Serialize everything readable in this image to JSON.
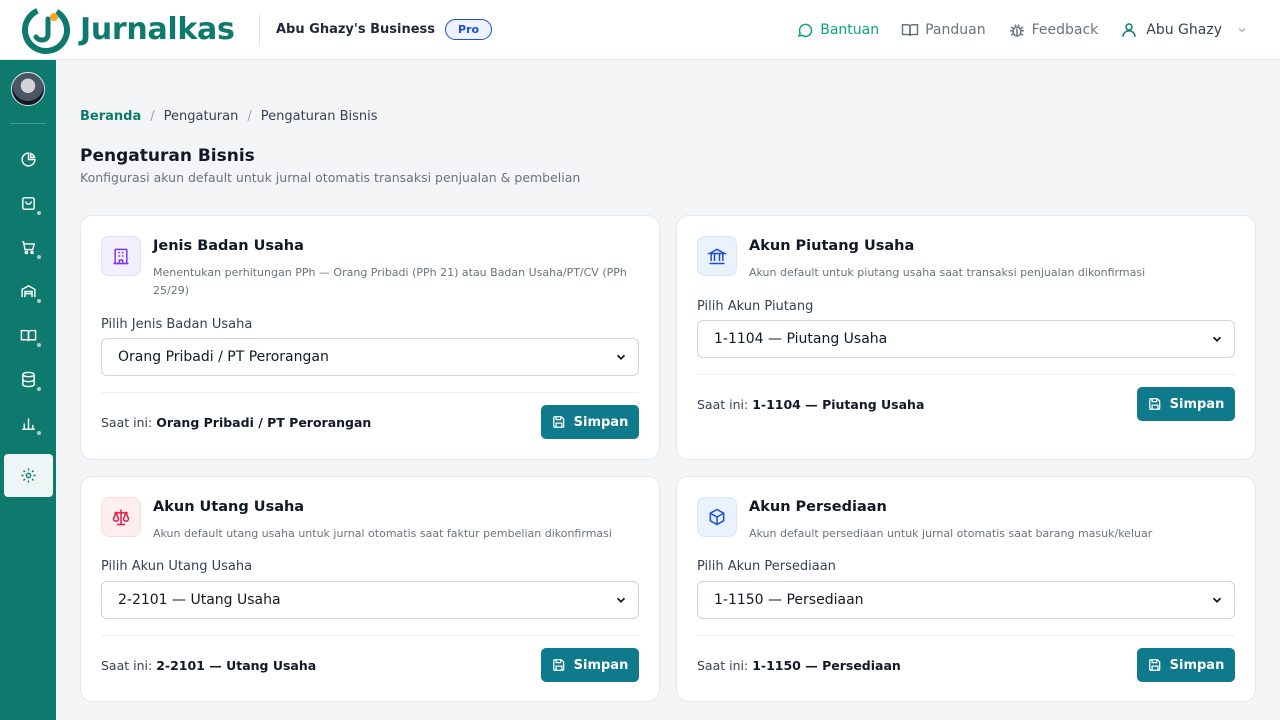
{
  "brand": {
    "name": "Jurnalkas"
  },
  "business": {
    "name": "Abu Ghazy's Business",
    "plan": "Pro"
  },
  "top_nav": {
    "help": "Bantuan",
    "guide": "Panduan",
    "feedback": "Feedback",
    "user": "Abu Ghazy"
  },
  "breadcrumb": {
    "home": "Beranda",
    "sep": "/",
    "level1": "Pengaturan",
    "level2": "Pengaturan Bisnis"
  },
  "page": {
    "title": "Pengaturan Bisnis",
    "subtitle": "Konfigurasi akun default untuk jurnal otomatis transaksi penjualan & pembelian"
  },
  "colors": {
    "brand": "#0e7a6e",
    "button": "#0e7a8c",
    "help": "#10a37f",
    "pro": "#1d4ed8"
  },
  "cards": [
    {
      "title": "Jenis Badan Usaha",
      "description": "Menentukan perhitungan PPh — Orang Pribadi (PPh 21) atau Badan Usaha/PT/CV (PPh 25/29)",
      "field_label": "Pilih Jenis Badan Usaha",
      "selected": "Orang Pribadi / PT Perorangan",
      "current_prefix": "Saat ini:",
      "current_value": "Orang Pribadi / PT Perorangan",
      "button": "Simpan",
      "icon": "building-icon"
    },
    {
      "title": "Akun Piutang Usaha",
      "description": "Akun default untuk piutang usaha saat transaksi penjualan dikonfirmasi",
      "field_label": "Pilih Akun Piutang",
      "selected": "1-1104 — Piutang Usaha",
      "current_prefix": "Saat ini:",
      "current_value": "1-1104 — Piutang Usaha",
      "button": "Simpan",
      "icon": "bank-icon"
    },
    {
      "title": "Akun Utang Usaha",
      "description": "Akun default utang usaha untuk jurnal otomatis saat faktur pembelian dikonfirmasi",
      "field_label": "Pilih Akun Utang Usaha",
      "selected": "2-2101 — Utang Usaha",
      "current_prefix": "Saat ini:",
      "current_value": "2-2101 — Utang Usaha",
      "button": "Simpan",
      "icon": "scale-icon"
    },
    {
      "title": "Akun Persediaan",
      "description": "Akun default persediaan untuk jurnal otomatis saat barang masuk/keluar",
      "field_label": "Pilih Akun Persediaan",
      "selected": "1-1150 — Persediaan",
      "current_prefix": "Saat ini:",
      "current_value": "1-1150 — Persediaan",
      "button": "Simpan",
      "icon": "box-icon"
    }
  ]
}
